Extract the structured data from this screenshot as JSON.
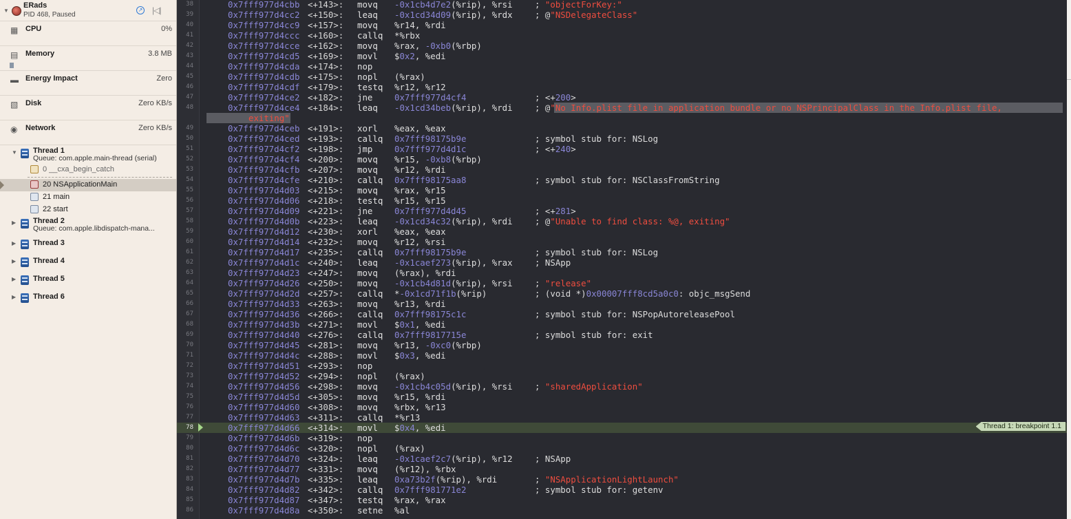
{
  "process": {
    "name": "ERads",
    "status": "PID 468, Paused"
  },
  "gauges": [
    {
      "label": "CPU",
      "value": "0%",
      "icon": "cpu-icon"
    },
    {
      "label": "Memory",
      "value": "3.8 MB",
      "icon": "memory-icon"
    },
    {
      "label": "Energy Impact",
      "value": "Zero",
      "icon": "energy-icon"
    },
    {
      "label": "Disk",
      "value": "Zero KB/s",
      "icon": "disk-icon"
    },
    {
      "label": "Network",
      "value": "Zero KB/s",
      "icon": "network-icon"
    }
  ],
  "threads": [
    {
      "name": "Thread 1",
      "queue": "Queue: com.apple.main-thread (serial)",
      "expanded": true,
      "frames": [
        {
          "label": "0 __cxa_begin_catch",
          "icon": "gear"
        },
        {
          "label": "20 NSApplicationMain",
          "icon": "app",
          "selected": true
        },
        {
          "label": "21 main",
          "icon": "user"
        },
        {
          "label": "22 start",
          "icon": "user"
        }
      ]
    },
    {
      "name": "Thread 2",
      "queue": "Queue: com.apple.libdispatch-mana..."
    },
    {
      "name": "Thread 3",
      "queue": ""
    },
    {
      "name": "Thread 4",
      "queue": ""
    },
    {
      "name": "Thread 5",
      "queue": ""
    },
    {
      "name": "Thread 6",
      "queue": ""
    }
  ],
  "breakpoint_label": "Thread 1: breakpoint 1.1",
  "current_line": 78,
  "wrapped_continuation": "exiting\"",
  "asm": [
    {
      "n": 38,
      "a": "0x7fff977d4cbb",
      "o": "<+143>:",
      "m": "movq",
      "ops": "-0x1cb4d7e2(%rip), %rsi",
      "c": "; \"objectForKey:\""
    },
    {
      "n": 39,
      "a": "0x7fff977d4cc2",
      "o": "<+150>:",
      "m": "leaq",
      "ops": "-0x1cd34d09(%rip), %rdx",
      "c": "; @\"NSDelegateClass\""
    },
    {
      "n": 40,
      "a": "0x7fff977d4cc9",
      "o": "<+157>:",
      "m": "movq",
      "ops": "%r14, %rdi",
      "c": ""
    },
    {
      "n": 41,
      "a": "0x7fff977d4ccc",
      "o": "<+160>:",
      "m": "callq",
      "ops": "*%rbx",
      "c": ""
    },
    {
      "n": 42,
      "a": "0x7fff977d4cce",
      "o": "<+162>:",
      "m": "movq",
      "ops": "%rax, -0xb0(%rbp)",
      "c": ""
    },
    {
      "n": 43,
      "a": "0x7fff977d4cd5",
      "o": "<+169>:",
      "m": "movl",
      "ops": "$0x2, %edi",
      "c": ""
    },
    {
      "n": 44,
      "a": "0x7fff977d4cda",
      "o": "<+174>:",
      "m": "nop",
      "ops": "",
      "c": ""
    },
    {
      "n": 45,
      "a": "0x7fff977d4cdb",
      "o": "<+175>:",
      "m": "nopl",
      "ops": "(%rax)",
      "c": ""
    },
    {
      "n": 46,
      "a": "0x7fff977d4cdf",
      "o": "<+179>:",
      "m": "testq",
      "ops": "%r12, %r12",
      "c": ""
    },
    {
      "n": 47,
      "a": "0x7fff977d4ce2",
      "o": "<+182>:",
      "m": "jne",
      "ops": "0x7fff977d4cf4",
      "c": "; <+200>"
    },
    {
      "n": 48,
      "a": "0x7fff977d4ce4",
      "o": "<+184>:",
      "m": "leaq",
      "ops": "-0x1cd34beb(%rip), %rdi",
      "c": "; @\"No Info.plist file in application bundle or no NSPrincipalClass in the Info.plist file,"
    },
    {
      "n": 49,
      "a": "0x7fff977d4ceb",
      "o": "<+191>:",
      "m": "xorl",
      "ops": "%eax, %eax",
      "c": ""
    },
    {
      "n": 50,
      "a": "0x7fff977d4ced",
      "o": "<+193>:",
      "m": "callq",
      "ops": "0x7fff98175b9e",
      "c": "; symbol stub for: NSLog"
    },
    {
      "n": 51,
      "a": "0x7fff977d4cf2",
      "o": "<+198>:",
      "m": "jmp",
      "ops": "0x7fff977d4d1c",
      "c": "; <+240>"
    },
    {
      "n": 52,
      "a": "0x7fff977d4cf4",
      "o": "<+200>:",
      "m": "movq",
      "ops": "%r15, -0xb8(%rbp)",
      "c": ""
    },
    {
      "n": 53,
      "a": "0x7fff977d4cfb",
      "o": "<+207>:",
      "m": "movq",
      "ops": "%r12, %rdi",
      "c": ""
    },
    {
      "n": 54,
      "a": "0x7fff977d4cfe",
      "o": "<+210>:",
      "m": "callq",
      "ops": "0x7fff98175aa8",
      "c": "; symbol stub for: NSClassFromString"
    },
    {
      "n": 55,
      "a": "0x7fff977d4d03",
      "o": "<+215>:",
      "m": "movq",
      "ops": "%rax, %r15",
      "c": ""
    },
    {
      "n": 56,
      "a": "0x7fff977d4d06",
      "o": "<+218>:",
      "m": "testq",
      "ops": "%r15, %r15",
      "c": ""
    },
    {
      "n": 57,
      "a": "0x7fff977d4d09",
      "o": "<+221>:",
      "m": "jne",
      "ops": "0x7fff977d4d45",
      "c": "; <+281>"
    },
    {
      "n": 58,
      "a": "0x7fff977d4d0b",
      "o": "<+223>:",
      "m": "leaq",
      "ops": "-0x1cd34c32(%rip), %rdi",
      "c": "; @\"Unable to find class: %@, exiting\""
    },
    {
      "n": 59,
      "a": "0x7fff977d4d12",
      "o": "<+230>:",
      "m": "xorl",
      "ops": "%eax, %eax",
      "c": ""
    },
    {
      "n": 60,
      "a": "0x7fff977d4d14",
      "o": "<+232>:",
      "m": "movq",
      "ops": "%r12, %rsi",
      "c": ""
    },
    {
      "n": 61,
      "a": "0x7fff977d4d17",
      "o": "<+235>:",
      "m": "callq",
      "ops": "0x7fff98175b9e",
      "c": "; symbol stub for: NSLog"
    },
    {
      "n": 62,
      "a": "0x7fff977d4d1c",
      "o": "<+240>:",
      "m": "leaq",
      "ops": "-0x1caef273(%rip), %rax",
      "c": "; NSApp"
    },
    {
      "n": 63,
      "a": "0x7fff977d4d23",
      "o": "<+247>:",
      "m": "movq",
      "ops": "(%rax), %rdi",
      "c": ""
    },
    {
      "n": 64,
      "a": "0x7fff977d4d26",
      "o": "<+250>:",
      "m": "movq",
      "ops": "-0x1cb4d81d(%rip), %rsi",
      "c": "; \"release\""
    },
    {
      "n": 65,
      "a": "0x7fff977d4d2d",
      "o": "<+257>:",
      "m": "callq",
      "ops": "*-0x1cd71f1b(%rip)",
      "c": "; (void *)0x00007fff8cd5a0c0: objc_msgSend"
    },
    {
      "n": 66,
      "a": "0x7fff977d4d33",
      "o": "<+263>:",
      "m": "movq",
      "ops": "%r13, %rdi",
      "c": ""
    },
    {
      "n": 67,
      "a": "0x7fff977d4d36",
      "o": "<+266>:",
      "m": "callq",
      "ops": "0x7fff98175c1c",
      "c": "; symbol stub for: NSPopAutoreleasePool"
    },
    {
      "n": 68,
      "a": "0x7fff977d4d3b",
      "o": "<+271>:",
      "m": "movl",
      "ops": "$0x1, %edi",
      "c": ""
    },
    {
      "n": 69,
      "a": "0x7fff977d4d40",
      "o": "<+276>:",
      "m": "callq",
      "ops": "0x7fff9817715e",
      "c": "; symbol stub for: exit"
    },
    {
      "n": 70,
      "a": "0x7fff977d4d45",
      "o": "<+281>:",
      "m": "movq",
      "ops": "%r13, -0xc0(%rbp)",
      "c": ""
    },
    {
      "n": 71,
      "a": "0x7fff977d4d4c",
      "o": "<+288>:",
      "m": "movl",
      "ops": "$0x3, %edi",
      "c": ""
    },
    {
      "n": 72,
      "a": "0x7fff977d4d51",
      "o": "<+293>:",
      "m": "nop",
      "ops": "",
      "c": ""
    },
    {
      "n": 73,
      "a": "0x7fff977d4d52",
      "o": "<+294>:",
      "m": "nopl",
      "ops": "(%rax)",
      "c": ""
    },
    {
      "n": 74,
      "a": "0x7fff977d4d56",
      "o": "<+298>:",
      "m": "movq",
      "ops": "-0x1cb4c05d(%rip), %rsi",
      "c": "; \"sharedApplication\""
    },
    {
      "n": 75,
      "a": "0x7fff977d4d5d",
      "o": "<+305>:",
      "m": "movq",
      "ops": "%r15, %rdi",
      "c": ""
    },
    {
      "n": 76,
      "a": "0x7fff977d4d60",
      "o": "<+308>:",
      "m": "movq",
      "ops": "%rbx, %r13",
      "c": ""
    },
    {
      "n": 77,
      "a": "0x7fff977d4d63",
      "o": "<+311>:",
      "m": "callq",
      "ops": "*%r13",
      "c": ""
    },
    {
      "n": 78,
      "a": "0x7fff977d4d66",
      "o": "<+314>:",
      "m": "movl",
      "ops": "$0x4, %edi",
      "c": ""
    },
    {
      "n": 79,
      "a": "0x7fff977d4d6b",
      "o": "<+319>:",
      "m": "nop",
      "ops": "",
      "c": ""
    },
    {
      "n": 80,
      "a": "0x7fff977d4d6c",
      "o": "<+320>:",
      "m": "nopl",
      "ops": "(%rax)",
      "c": ""
    },
    {
      "n": 81,
      "a": "0x7fff977d4d70",
      "o": "<+324>:",
      "m": "leaq",
      "ops": "-0x1caef2c7(%rip), %r12",
      "c": "; NSApp"
    },
    {
      "n": 82,
      "a": "0x7fff977d4d77",
      "o": "<+331>:",
      "m": "movq",
      "ops": "(%r12), %rbx",
      "c": ""
    },
    {
      "n": 83,
      "a": "0x7fff977d4d7b",
      "o": "<+335>:",
      "m": "leaq",
      "ops": "0xa73b2f(%rip), %rdi",
      "c": "; \"NSApplicationLightLaunch\""
    },
    {
      "n": 84,
      "a": "0x7fff977d4d82",
      "o": "<+342>:",
      "m": "callq",
      "ops": "0x7fff981771e2",
      "c": "; symbol stub for: getenv"
    },
    {
      "n": 85,
      "a": "0x7fff977d4d87",
      "o": "<+347>:",
      "m": "testq",
      "ops": "%rax, %rax",
      "c": ""
    },
    {
      "n": 86,
      "a": "0x7fff977d4d8a",
      "o": "<+350>:",
      "m": "setne",
      "ops": "%al",
      "c": ""
    }
  ]
}
